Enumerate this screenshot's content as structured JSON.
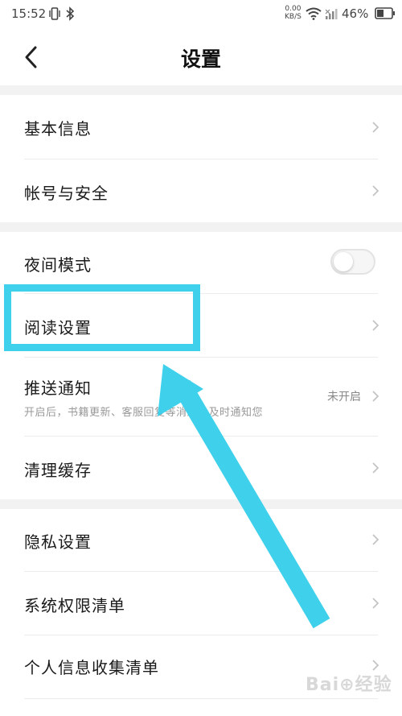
{
  "status_bar": {
    "time": "15:52",
    "net_speed_value": "0.00",
    "net_speed_unit": "KB/S",
    "battery": "46%"
  },
  "header": {
    "title": "设置"
  },
  "settings": {
    "basic_info": "基本信息",
    "account_security": "帐号与安全",
    "night_mode": "夜间模式",
    "night_mode_on": false,
    "reading_settings": "阅读设置",
    "push_notify": "推送通知",
    "push_notify_desc": "开启后，书籍更新、客服回复等消息会及时通知您",
    "push_notify_status": "未开启",
    "clear_cache": "清理缓存",
    "privacy": "隐私设置",
    "permissions": "系统权限清单",
    "personal_info": "个人信息收集清单"
  },
  "annotation": {
    "highlight_color": "#3fd1ec"
  },
  "watermark": "Bai⊕经验"
}
